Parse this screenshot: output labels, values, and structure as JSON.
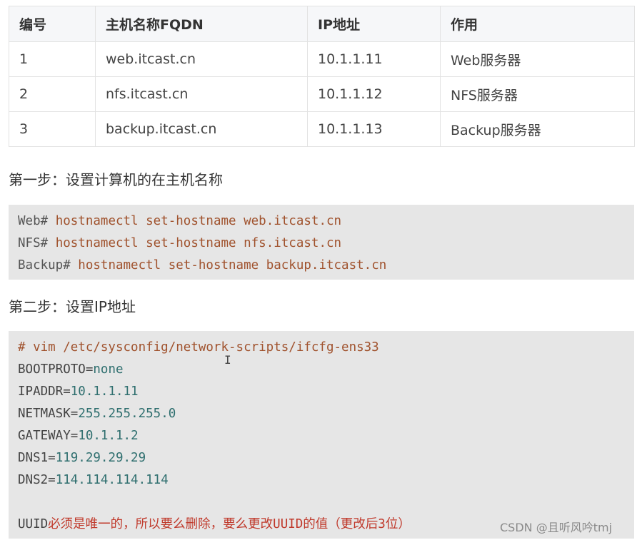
{
  "table": {
    "headers": [
      "编号",
      "主机名称FQDN",
      "IP地址",
      "作用"
    ],
    "rows": [
      [
        "1",
        "web.itcast.cn",
        "10.1.1.11",
        "Web服务器"
      ],
      [
        "2",
        "nfs.itcast.cn",
        "10.1.1.12",
        "NFS服务器"
      ],
      [
        "3",
        "backup.itcast.cn",
        "10.1.1.13",
        "Backup服务器"
      ]
    ]
  },
  "step1": {
    "heading": "第一步：设置计算机的在主机名称",
    "lines": [
      {
        "prompt": "Web#",
        "command": " hostnamectl set-hostname web.itcast.cn"
      },
      {
        "prompt": "NFS#",
        "command": " hostnamectl set-hostname nfs.itcast.cn"
      },
      {
        "prompt": "Backup#",
        "command": " hostnamectl set-hostname backup.itcast.cn"
      }
    ]
  },
  "step2": {
    "heading": "第二步：设置IP地址",
    "comment": "# vim /etc/sysconfig/network-scripts/ifcfg-ens33",
    "config": [
      {
        "key": "BOOTPROTO",
        "value": "none"
      },
      {
        "key": "IPADDR",
        "value": "10.1.1.11"
      },
      {
        "key": "NETMASK",
        "value": "255.255.255.0"
      },
      {
        "key": "GATEWAY",
        "value": "10.1.1.2"
      },
      {
        "key": "DNS1",
        "value": "119.29.29.29"
      },
      {
        "key": "DNS2",
        "value": "114.114.114.114"
      }
    ],
    "note_key": "UUID",
    "note_text": "必须是唯一的，所以要么删除，要么更改UUID的值（更改后3位）"
  },
  "cursor_glyph": "I",
  "watermark": "CSDN @且听风吟tmj",
  "colors": {
    "code_bg": "#e6e6e6",
    "command": "#a0522d",
    "value": "#2f6f6f",
    "note": "#c0392b"
  }
}
